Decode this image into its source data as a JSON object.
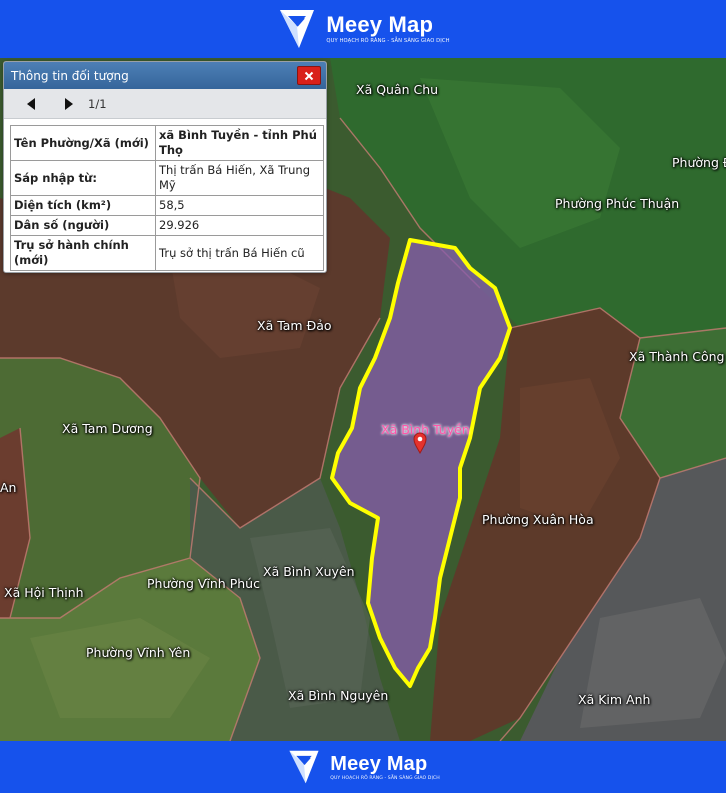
{
  "brand": {
    "name": "Meey Map",
    "tagline": "QUY HOẠCH RÕ RÀNG - SẴN SÀNG GIAO DỊCH",
    "colors": {
      "bar": "#1652ec",
      "logo": "#ffffff"
    }
  },
  "panel": {
    "title": "Thông tin đối tượng",
    "page": "1/1",
    "rows": [
      {
        "key": "Tên Phường/Xã (mới)",
        "value": "xã Bình Tuyền - tỉnh Phú Thọ"
      },
      {
        "key": "Sáp nhập từ:",
        "value": "Thị trấn Bá Hiến, Xã Trung Mỹ"
      },
      {
        "key": "Diện tích (km²)",
        "value": "58,5"
      },
      {
        "key": "Dân số (người)",
        "value": "29.926"
      },
      {
        "key": "Trụ sở hành chính (mới)",
        "value": "Trụ sở thị trấn Bá Hiến cũ"
      }
    ]
  },
  "map": {
    "selected_label": "Xã Bình Tuyền",
    "highlight_color": "#ffff00",
    "labels": [
      "Xã Quân Chu",
      "Phường Đ",
      "Phường Phúc Thuận",
      "Xã Tam Đảo",
      "Xã Thành Công",
      "Xã Tam Dương",
      "Phường Xuân Hòa",
      "Xã Bình Xuyên",
      "Phường Vĩnh Phúc",
      "Xã Hội Thịnh",
      "Phường Vĩnh Yên",
      "Xã Bình Nguyên",
      "Xã Kim Anh",
      "An"
    ]
  }
}
